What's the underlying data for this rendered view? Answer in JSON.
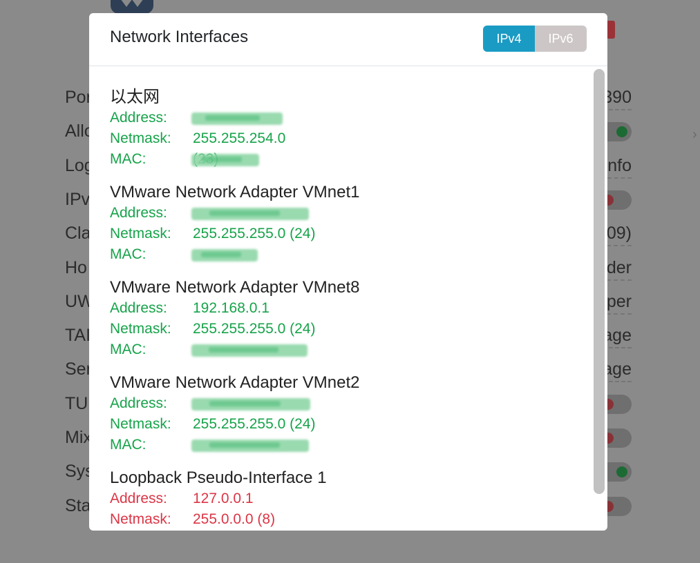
{
  "background": {
    "rows": [
      {
        "label": "Por",
        "value": "390",
        "kind": "text"
      },
      {
        "label": "Allo",
        "kind": "toggle",
        "state": "on"
      },
      {
        "label": "Log",
        "value": "nfo",
        "kind": "text"
      },
      {
        "label": "IPv",
        "kind": "toggle",
        "state": "off"
      },
      {
        "label": "Cla",
        "value": "09)",
        "kind": "text"
      },
      {
        "label": "Ho",
        "value": "der",
        "kind": "text"
      },
      {
        "label": "UW",
        "value": "per",
        "kind": "text"
      },
      {
        "label": "TAI",
        "value": "age",
        "kind": "text"
      },
      {
        "label": "Ser",
        "value": "age",
        "kind": "text"
      },
      {
        "label": "TU",
        "kind": "toggle",
        "state": "off"
      },
      {
        "label": "Mix",
        "kind": "toggle",
        "state": "off"
      },
      {
        "label": "Sys",
        "kind": "toggle",
        "state": "on"
      },
      {
        "label": "Sta",
        "kind": "toggle",
        "state": "off"
      }
    ],
    "chevron": "›"
  },
  "modal": {
    "title": "Network Interfaces",
    "tabs": [
      {
        "label": "IPv4",
        "active": true
      },
      {
        "label": "IPv6",
        "active": false
      }
    ]
  },
  "labels": {
    "address": "Address:",
    "netmask": "Netmask:",
    "mac": "MAC:"
  },
  "interfaces": [
    {
      "name": "以太网",
      "address": "",
      "address_blurred": true,
      "netmask": "255.255.254.0 (23)",
      "mac": "",
      "mac_blurred": true,
      "color": "green"
    },
    {
      "name": "VMware Network Adapter VMnet1",
      "address": "",
      "address_blurred": true,
      "netmask": "255.255.255.0 (24)",
      "mac": "",
      "mac_blurred": true,
      "color": "green"
    },
    {
      "name": "VMware Network Adapter VMnet8",
      "address": "192.168.0.1",
      "address_blurred": false,
      "netmask": "255.255.255.0 (24)",
      "mac": "",
      "mac_blurred": true,
      "color": "green"
    },
    {
      "name": "VMware Network Adapter VMnet2",
      "address": "",
      "address_blurred": true,
      "netmask": "255.255.255.0 (24)",
      "mac": "",
      "mac_blurred": true,
      "color": "green"
    },
    {
      "name": "Loopback Pseudo-Interface 1",
      "address": "127.0.0.1",
      "address_blurred": false,
      "netmask": "255.0.0.0 (8)",
      "mac": null,
      "color": "red"
    }
  ],
  "colors": {
    "accent": "#1a9bc4",
    "inactive_tab": "#cdc6c6",
    "up": "#16a34a",
    "down": "#dc3545",
    "overlay": "#8a8a8a"
  }
}
